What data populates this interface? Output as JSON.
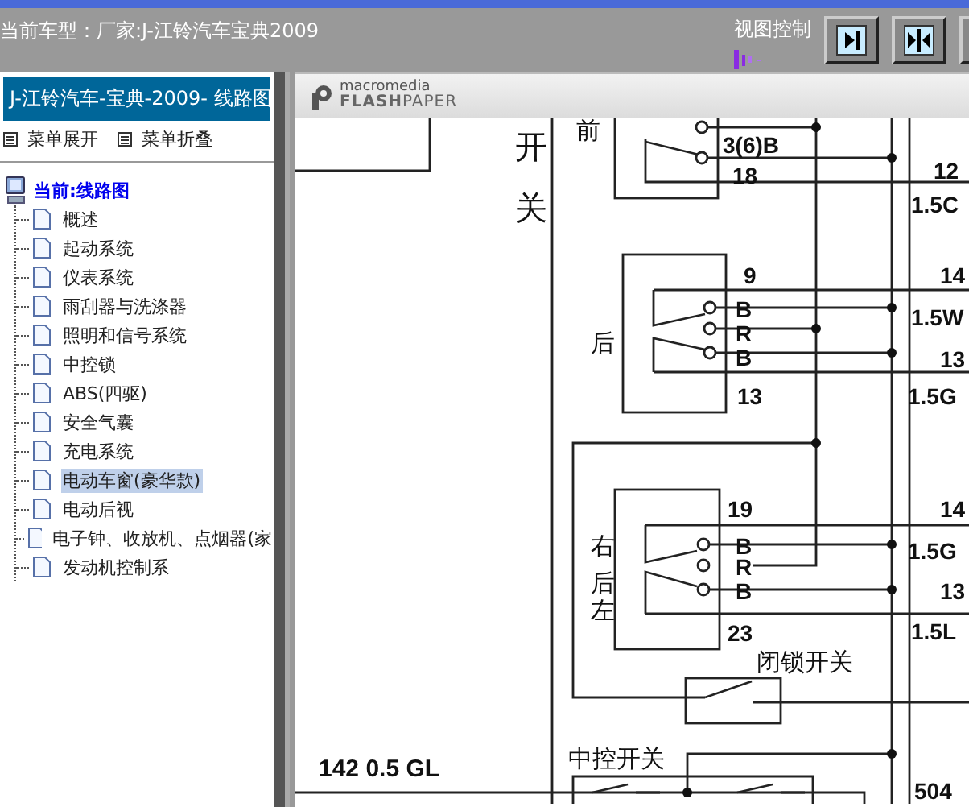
{
  "header": {
    "title": "当前车型：厂家:J-江铃汽车宝典2009",
    "view_control_label": "视图控制"
  },
  "sidebar": {
    "title": "J-江铃汽车-宝典-2009- 线路图",
    "menu_buttons": [
      "菜单展开",
      "菜单折叠"
    ],
    "tree": {
      "label": "当前:线路图",
      "children": [
        {
          "label": "概述",
          "selected": false
        },
        {
          "label": "起动系统",
          "selected": false
        },
        {
          "label": "仪表系统",
          "selected": false
        },
        {
          "label": "雨刮器与洗涤器",
          "selected": false
        },
        {
          "label": "照明和信号系统",
          "selected": false
        },
        {
          "label": "中控锁",
          "selected": false
        },
        {
          "label": "ABS(四驱)",
          "selected": false
        },
        {
          "label": "安全气囊",
          "selected": false
        },
        {
          "label": "充电系统",
          "selected": false
        },
        {
          "label": "电动车窗(豪华款)",
          "selected": true
        },
        {
          "label": "电动后视",
          "selected": false
        },
        {
          "label": "电子钟、收放机、点烟器(家",
          "selected": false
        },
        {
          "label": "发动机控制系",
          "selected": false
        }
      ]
    }
  },
  "viewer": {
    "brand_top": "macromedia",
    "brand": "**FLASH**PAPER",
    "diagram_labels": [
      {
        "text": "开",
        "kind": "caption"
      },
      {
        "text": "关",
        "kind": "caption"
      },
      {
        "text": "前",
        "kind": "caption"
      },
      {
        "text": "3(6)B",
        "kind": "code"
      },
      {
        "text": "18",
        "kind": "code"
      },
      {
        "text": "12",
        "kind": "code"
      },
      {
        "text": "1.5C",
        "kind": "code"
      },
      {
        "text": "9",
        "kind": "code"
      },
      {
        "text": "14",
        "kind": "code"
      },
      {
        "text": "B",
        "kind": "code"
      },
      {
        "text": "1.5W",
        "kind": "code"
      },
      {
        "text": "R",
        "kind": "code"
      },
      {
        "text": "B",
        "kind": "code"
      },
      {
        "text": "13",
        "kind": "code"
      },
      {
        "text": "13",
        "kind": "code"
      },
      {
        "text": "1.5G",
        "kind": "code"
      },
      {
        "text": "后",
        "kind": "caption"
      },
      {
        "text": "19",
        "kind": "code"
      },
      {
        "text": "14",
        "kind": "code"
      },
      {
        "text": "B",
        "kind": "code"
      },
      {
        "text": "1.5G",
        "kind": "code"
      },
      {
        "text": "R",
        "kind": "code"
      },
      {
        "text": "B",
        "kind": "code"
      },
      {
        "text": "13",
        "kind": "code"
      },
      {
        "text": "23",
        "kind": "code"
      },
      {
        "text": "1.5L",
        "kind": "code"
      },
      {
        "text": "右",
        "kind": "caption"
      },
      {
        "text": "后",
        "kind": "caption"
      },
      {
        "text": "左",
        "kind": "caption"
      },
      {
        "text": "闭锁开关",
        "kind": "caption"
      },
      {
        "text": "中控开关",
        "kind": "caption"
      },
      {
        "text": "142 0.5 GL",
        "kind": "code"
      },
      {
        "text": "504",
        "kind": "code"
      }
    ]
  }
}
